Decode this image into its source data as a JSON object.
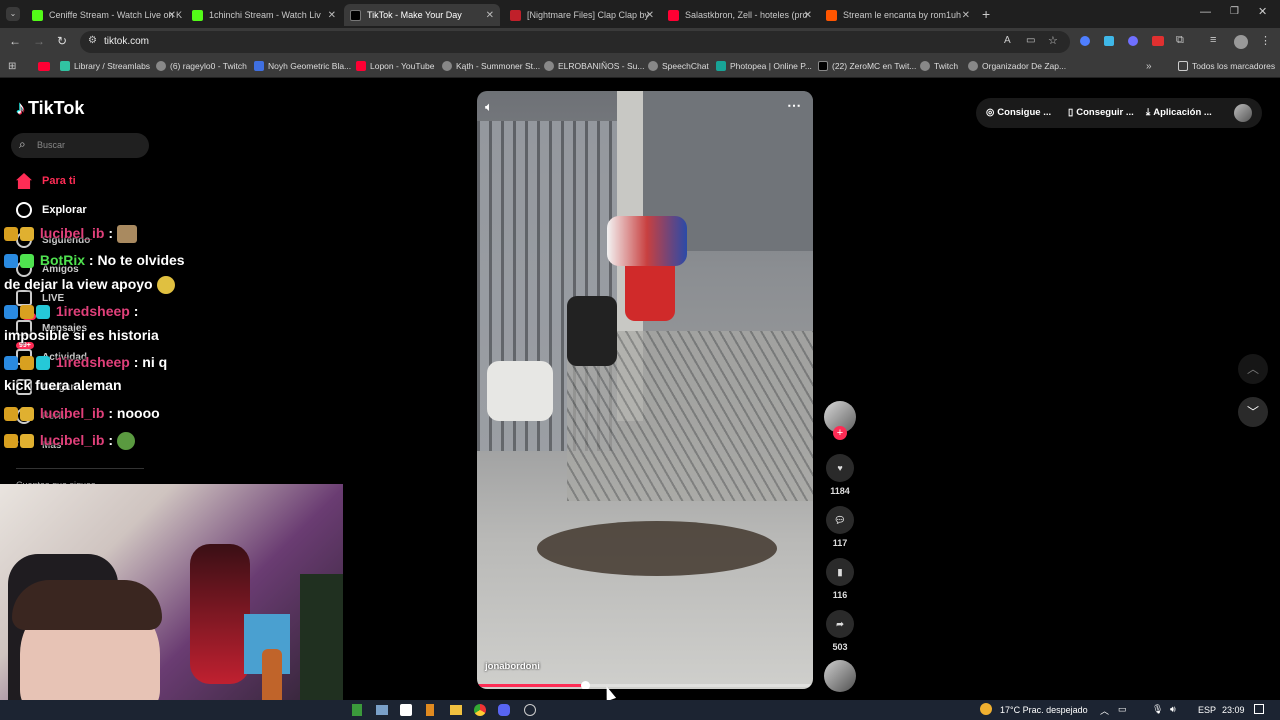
{
  "browser": {
    "tabs": [
      {
        "title": "Ceniffe Stream - Watch Live on K",
        "color": "#53fc18"
      },
      {
        "title": "1chinchi Stream - Watch Liv",
        "color": "#53fc18"
      },
      {
        "title": "TikTok - Make Your Day",
        "color": "#ffffff"
      },
      {
        "title": "[Nightmare Files] Clap Clap by",
        "color": "#c0202a"
      },
      {
        "title": "Salastkbron, Zell - hoteles (pro",
        "color": "#ff0033"
      },
      {
        "title": "Stream le encanta by rom1uh",
        "color": "#ff5500"
      }
    ],
    "url": "tiktok.com",
    "bookmarks": [
      "Library / Streamlabs",
      "(6) rageylo0 - Twitch",
      "Noyh Geometric Bla...",
      "Lopon - YouTube",
      "Kąth - Summoner St...",
      "ELROBANIÑOS - Su...",
      "SpeechChat",
      "Photopea | Online P...",
      "(22) ZeroMC en Twit...",
      "Twitch",
      "Organizador De Zap...",
      "Todos los marcadores"
    ]
  },
  "tiktok": {
    "logo": "TikTok",
    "search_placeholder": "Buscar",
    "nav": [
      "Para ti",
      "Explorar",
      "Siguiendo",
      "Amigos",
      "LIVE",
      "Mensajes",
      "Actividad",
      "Cargar",
      "Perfil",
      "Más"
    ],
    "badge_messages": "46",
    "badge_activity": "99+",
    "following_header": "Cuentas que sigues",
    "top_buttons": [
      "Consigue ...",
      "Conseguir ...",
      "Aplicación ..."
    ],
    "video_author": "jonabordoni",
    "actions": {
      "likes": "1184",
      "comments": "117",
      "saves": "116",
      "shares": "503"
    },
    "progress": 0.32
  },
  "chat": [
    {
      "user": "lucibel_ib",
      "msg": ":"
    },
    {
      "user": "BotRix",
      "msg": ": No te olvides"
    },
    {
      "line": "de dejar la view apoyo"
    },
    {
      "user": "1iredsheep",
      "msg": ":"
    },
    {
      "line": "imposible si es historia"
    },
    {
      "user": "1iredsheep",
      "msg": ": ni q"
    },
    {
      "line": "kick fuera aleman"
    },
    {
      "user": "lucibel_ib",
      "msg": ": noooo"
    },
    {
      "user": "lucibel_ib",
      "msg": ":"
    }
  ],
  "taskbar": {
    "weather": "17°C  Prac. despejado",
    "lang": "ESP",
    "time": "23:09"
  }
}
